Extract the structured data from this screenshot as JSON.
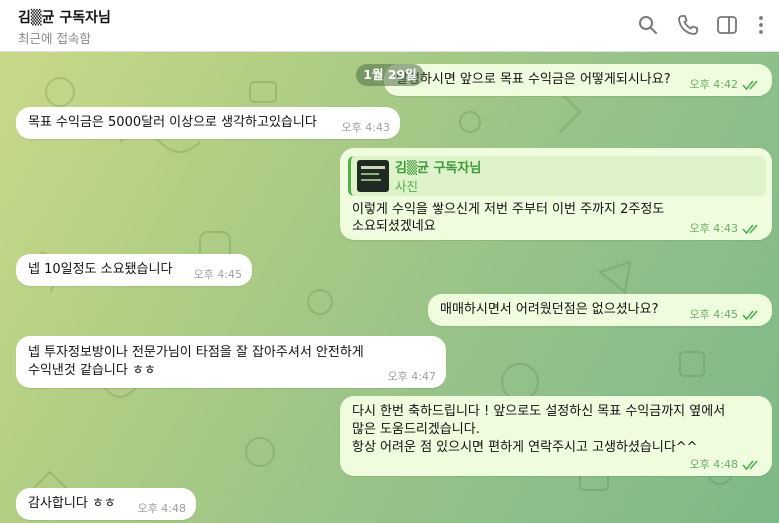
{
  "header": {
    "name": "김▒균 구독자님",
    "status": "최근에 접속함",
    "icons": [
      "search-icon",
      "phone-icon",
      "sidebar-icon",
      "more-icon"
    ]
  },
  "chat": {
    "date": "1월 29일",
    "messages": [
      {
        "text": "달성하시면 앞으로 목표 수익금은 어떻게되시나요?",
        "time": "오후 4:42",
        "dir": "out"
      },
      {
        "text": "목표 수익금은 5000달러 이상으로 생각하고있습니다",
        "time": "오후 4:43",
        "dir": "in"
      },
      {
        "reply_name": "김▒균 구독자님",
        "reply_type": "사진",
        "lines": [
          "이렇게 수익을 쌓으신게  저번 주부터 이번 주까지 2주정도",
          "소요되셨겠네요"
        ],
        "time": "오후 4:43",
        "dir": "out"
      },
      {
        "text": "넵 10일정도 소요됐습니다",
        "time": "오후 4:45",
        "dir": "in"
      },
      {
        "text": "매매하시면서 어려웠던점은 없으셨나요?",
        "time": "오후 4:45",
        "dir": "out"
      },
      {
        "lines": [
          "넵 투자정보방이나 전문가님이 타점을 잘 잡아주셔서 안전하게",
          "수익낸것 같습니다 ㅎㅎ"
        ],
        "time": "오후 4:47",
        "dir": "in"
      },
      {
        "lines": [
          "다시 한번 축하드립니다 ! 앞으로도 설정하신 목표 수익금까지 옆에서",
          "많은 도움드리겠습니다.",
          "항상 어려운 점 있으시면 편하게 연락주시고 고생하셨습니다^^"
        ],
        "time": "오후 4:48",
        "dir": "out"
      },
      {
        "text": "감사합니다 ㅎㅎ",
        "time": "오후 4:48",
        "dir": "in"
      }
    ]
  }
}
